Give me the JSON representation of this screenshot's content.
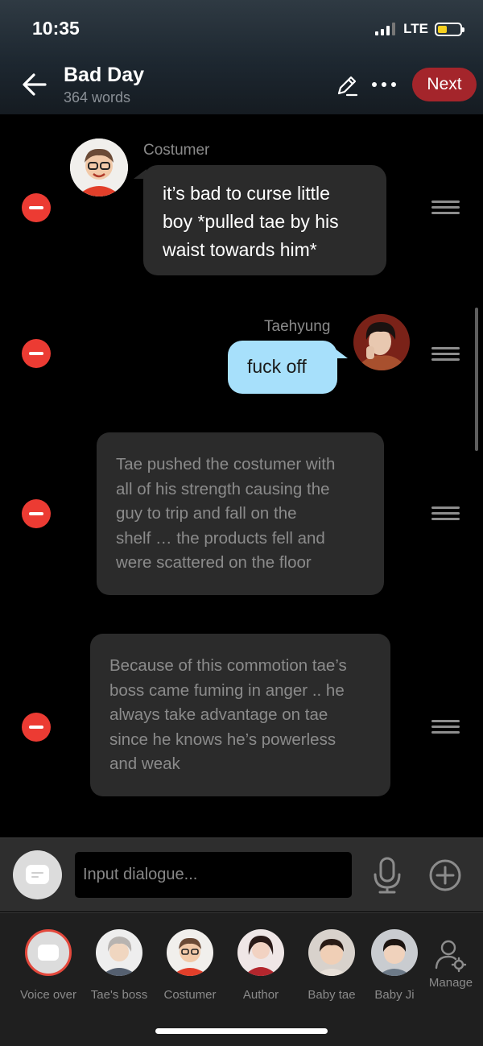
{
  "status": {
    "time": "10:35",
    "network": "LTE"
  },
  "header": {
    "title": "Bad Day",
    "subtitle": "364 words",
    "next_label": "Next"
  },
  "messages": [
    {
      "speaker": "Costumer",
      "lines": [
        "it’s bad to curse little",
        "boy *pulled tae by his",
        "waist towards him*"
      ]
    },
    {
      "speaker": "Taehyung",
      "lines": [
        "fuck off"
      ]
    },
    {
      "lines": [
        "Tae pushed the costumer with",
        "all of his strength causing the",
        "guy to trip and fall on the",
        "shelf … the products fell and",
        "were scattered on the floor"
      ]
    },
    {
      "lines": [
        "Because of this commotion tae’s",
        "boss came fuming in anger .. he",
        "always take advantage on tae",
        "since he knows he’s powerless",
        "and weak"
      ]
    }
  ],
  "input": {
    "placeholder": "Input dialogue..."
  },
  "characters": [
    {
      "label": "Voice over"
    },
    {
      "label": "Tae's boss"
    },
    {
      "label": "Costumer"
    },
    {
      "label": "Author"
    },
    {
      "label": "Baby tae"
    },
    {
      "label": "Baby Ji"
    },
    {
      "label": "Manage"
    }
  ],
  "colors": {
    "accent": "#a4252b",
    "delete": "#ec3b33",
    "user_bubble": "#a7e0fb",
    "bubble": "#2b2b2b"
  }
}
